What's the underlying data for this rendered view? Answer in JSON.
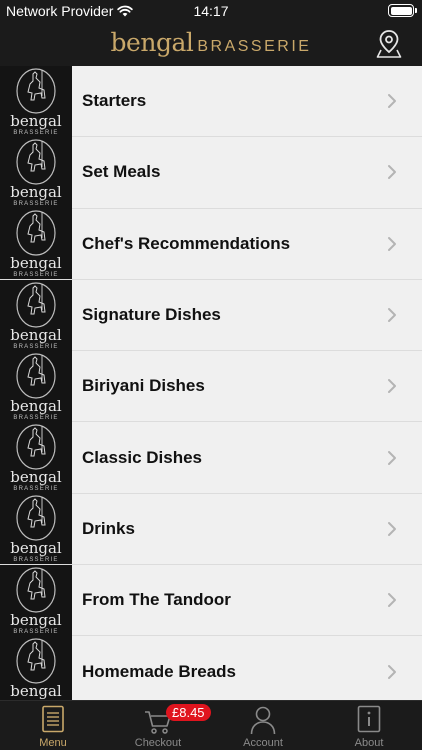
{
  "status_bar": {
    "carrier": "Network Provider",
    "time": "14:17"
  },
  "header": {
    "logo_script": "bengal",
    "logo_caps": "BRASSERIE"
  },
  "thumbnail": {
    "brand": "bengal",
    "sub": "BRASSERIE"
  },
  "menu": {
    "items": [
      {
        "label": "Starters"
      },
      {
        "label": "Set Meals"
      },
      {
        "label": "Chef's Recommendations"
      },
      {
        "label": "Signature Dishes"
      },
      {
        "label": "Biriyani Dishes"
      },
      {
        "label": "Classic Dishes"
      },
      {
        "label": "Drinks"
      },
      {
        "label": "From The Tandoor"
      },
      {
        "label": "Homemade Breads"
      }
    ]
  },
  "tabs": {
    "menu": "Menu",
    "checkout": "Checkout",
    "account": "Account",
    "about": "About",
    "cart_total": "£8.45"
  },
  "colors": {
    "brand_gold": "#c9a86a",
    "bar_background": "#1b1b1b",
    "badge_red": "#e0141e",
    "list_background": "#f0f0f0"
  },
  "icons": {
    "status": [
      "wifi-icon",
      "battery-icon"
    ],
    "header": "location-pin-icon",
    "row": "chevron-right-icon",
    "tabs": [
      "menu-book-icon",
      "cart-icon",
      "user-icon",
      "info-icon"
    ]
  }
}
